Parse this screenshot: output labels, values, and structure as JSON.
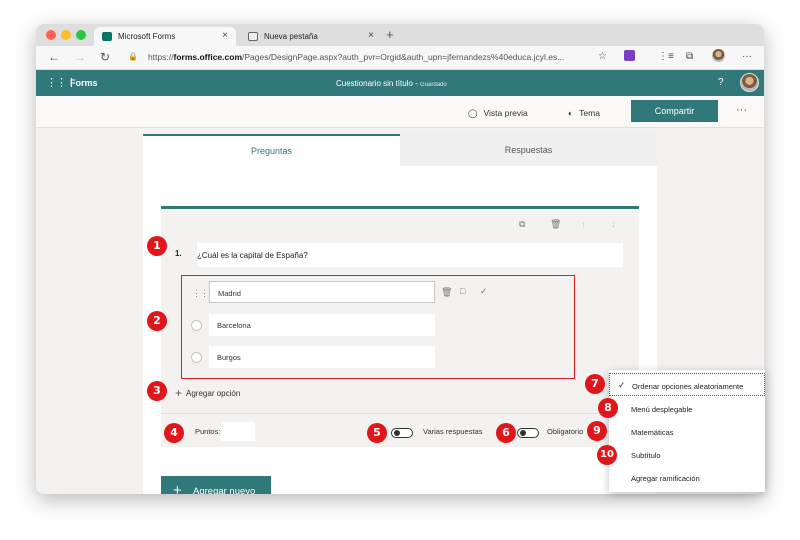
{
  "browser": {
    "tabs": [
      {
        "label": "Microsoft Forms",
        "icon": "forms-icon",
        "close": "×"
      },
      {
        "label": "Nueva pestaña",
        "icon": "newtab-page-icon",
        "close": "×"
      }
    ],
    "new_tab": "+",
    "url_prefix": "https://",
    "url_host": "forms.office.com",
    "url_rest": "/Pages/DesignPage.aspx?auth_pvr=Orgid&auth_upn=jfernandezs%40educa.jcyl.es...",
    "nav": {
      "back": "←",
      "forward": "→",
      "reload": "↻",
      "lock": "🔒"
    },
    "icons": {
      "star": "☆",
      "favorites": "⋮≡",
      "collections": "⧉",
      "more": "···"
    }
  },
  "forms_header": {
    "waffle": "⋮⋮⋮",
    "brand": "Forms",
    "title": "Cuestionario sin título",
    "status": "Guardado",
    "help": "?"
  },
  "toolbar": {
    "preview_label": "Vista previa",
    "theme_label": "Tema",
    "share_label": "Compartir",
    "more": "···"
  },
  "tabs": {
    "questions": "Preguntas",
    "responses": "Respuestas"
  },
  "question": {
    "number": "1.",
    "text": "¿Cuál es la capital de España?",
    "options": [
      "Madrid",
      "Barcelona",
      "Burgos"
    ],
    "add_option": "Agregar opción",
    "points_label": "Puntos:",
    "multiple_label": "Varias respuestas",
    "required_label": "Obligatorio"
  },
  "add_new": "Agregar nuevo",
  "menu": {
    "items": [
      "Ordenar opciones aleatoriamente",
      "Menú desplegable",
      "Matemáticas",
      "Subtítulo",
      "Agregar ramificación"
    ],
    "check": "✓"
  },
  "badges": [
    "1",
    "2",
    "3",
    "4",
    "5",
    "6",
    "7",
    "8",
    "9",
    "10"
  ],
  "colors": {
    "accent": "#31787a",
    "annotation": "#e0161b"
  }
}
